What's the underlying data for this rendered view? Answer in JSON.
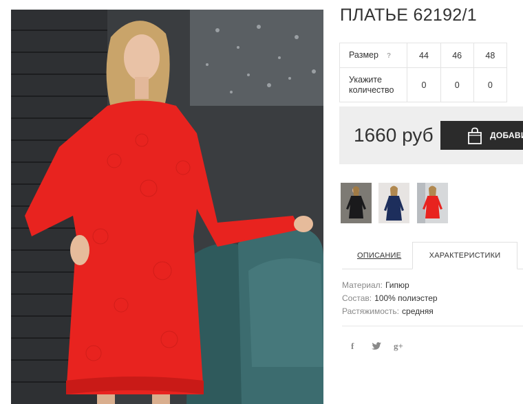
{
  "product": {
    "title": "ПЛАТЬЕ 62192/1"
  },
  "size_table": {
    "size_label": "Размер",
    "help_icon": "?",
    "quantity_label_line1": "Укажите",
    "quantity_label_line2": "количество",
    "sizes": [
      "44",
      "46",
      "48"
    ],
    "quantities": [
      "0",
      "0",
      "0"
    ]
  },
  "purchase": {
    "price": "1660 руб",
    "add_button_label": "ДОБАВИ",
    "bag_icon": "shopping-bag-icon"
  },
  "thumbnails": [
    {
      "name": "black-dress-thumbnail"
    },
    {
      "name": "navy-dress-thumbnail"
    },
    {
      "name": "red-dress-thumbnail"
    }
  ],
  "tabs": {
    "description": "ОПИСАНИЕ",
    "characteristics": "ХАРАКТЕРИСТИКИ",
    "active": "characteristics"
  },
  "characteristics": [
    {
      "key": "Материал:",
      "value": "Гипюр"
    },
    {
      "key": "Состав:",
      "value": "100% полиэстер"
    },
    {
      "key": "Растяжимость:",
      "value": "средняя"
    }
  ],
  "social": {
    "facebook": "f",
    "twitter_icon": "twitter-icon",
    "google_plus": "g+"
  },
  "colors": {
    "dress_red": "#e8231f",
    "button_dark": "#2b2b2b",
    "price_bg": "#eeeeee"
  }
}
